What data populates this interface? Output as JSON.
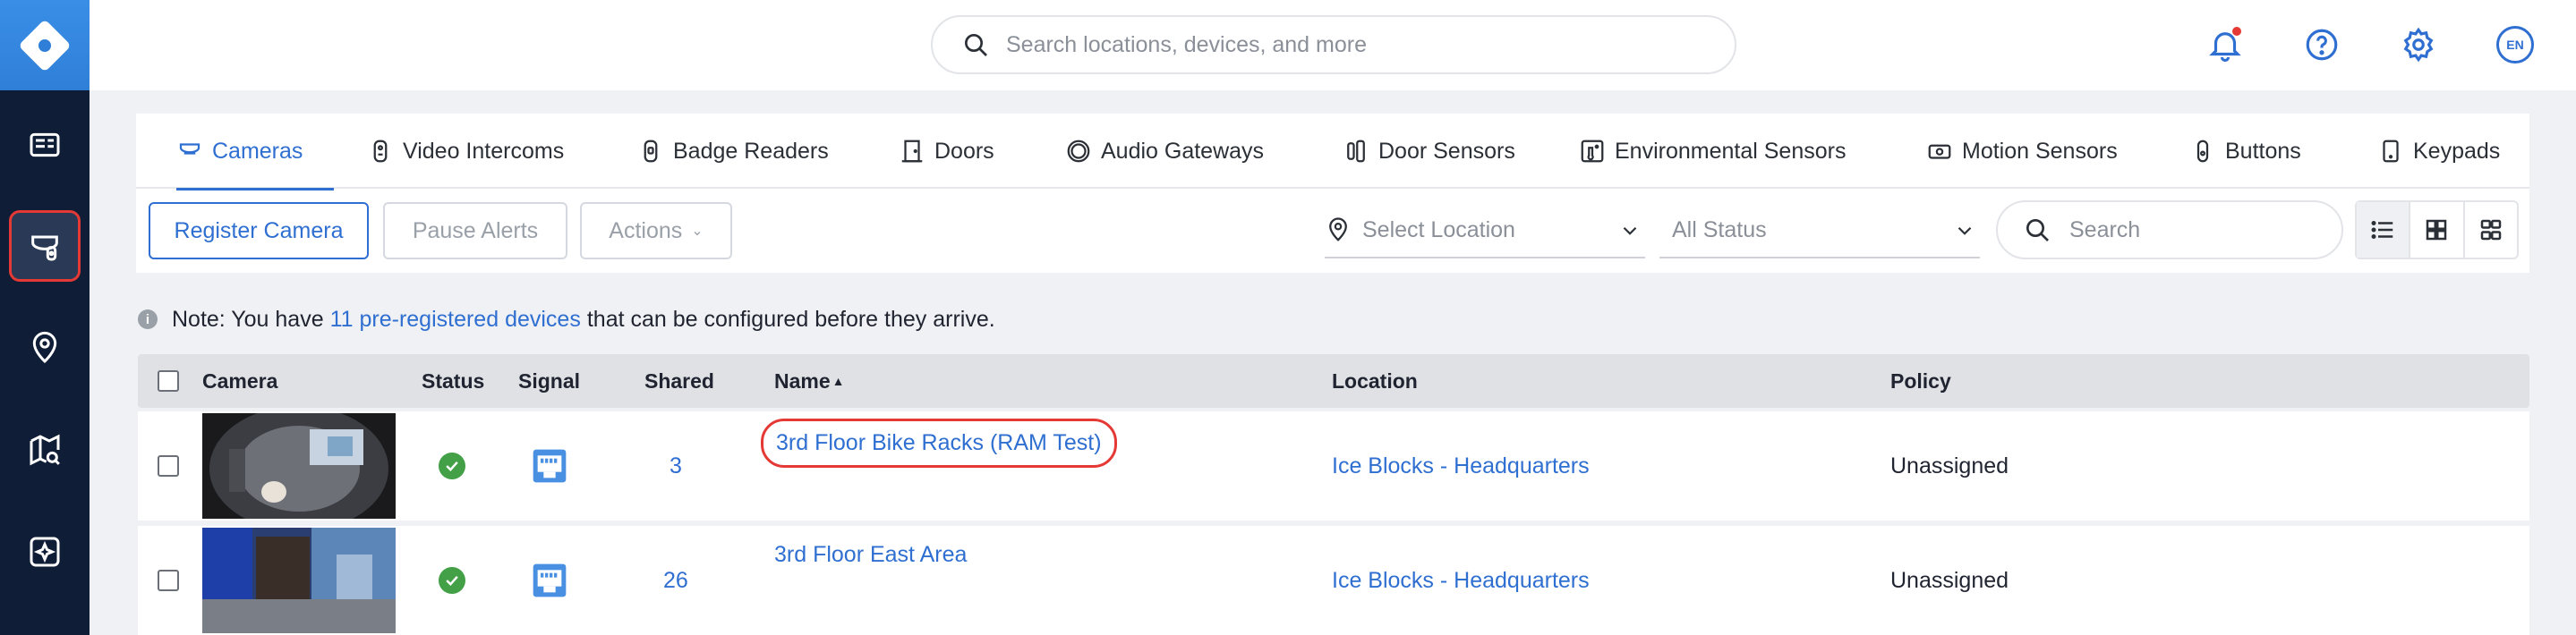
{
  "search": {
    "placeholder": "Search locations, devices, and more"
  },
  "header": {
    "language": "EN"
  },
  "tabs": [
    {
      "label": "Cameras",
      "icon": "camera-icon"
    },
    {
      "label": "Video Intercoms",
      "icon": "intercom-icon"
    },
    {
      "label": "Badge Readers",
      "icon": "badge-reader-icon"
    },
    {
      "label": "Doors",
      "icon": "door-icon"
    },
    {
      "label": "Audio Gateways",
      "icon": "audio-gateway-icon"
    },
    {
      "label": "Door Sensors",
      "icon": "door-sensor-icon"
    },
    {
      "label": "Environmental Sensors",
      "icon": "environmental-sensor-icon"
    },
    {
      "label": "Motion Sensors",
      "icon": "motion-sensor-icon"
    },
    {
      "label": "Buttons",
      "icon": "button-device-icon"
    },
    {
      "label": "Keypads",
      "icon": "keypad-icon"
    }
  ],
  "toolbar": {
    "register": "Register Camera",
    "pause": "Pause Alerts",
    "actions": "Actions",
    "location_placeholder": "Select Location",
    "status_value": "All Status",
    "search_placeholder": "Search"
  },
  "note": {
    "prefix": "Note: You have",
    "link": "11 pre-registered devices",
    "suffix": "that can be configured before they arrive."
  },
  "table": {
    "columns": {
      "camera": "Camera",
      "status": "Status",
      "signal": "Signal",
      "shared": "Shared",
      "name": "Name",
      "location": "Location",
      "policy": "Policy"
    },
    "rows": [
      {
        "shared": "3",
        "name": "3rd Floor Bike Racks (RAM Test)",
        "location": "Ice Blocks - Headquarters",
        "policy": "Unassigned",
        "status": "ok"
      },
      {
        "shared": "26",
        "name": "3rd Floor East Area",
        "location": "Ice Blocks - Headquarters",
        "policy": "Unassigned",
        "status": "ok"
      }
    ]
  },
  "colors": {
    "accent": "#2f6fd1",
    "rail": "#0f1d36",
    "highlight": "#e53935",
    "ok": "#43a047"
  }
}
